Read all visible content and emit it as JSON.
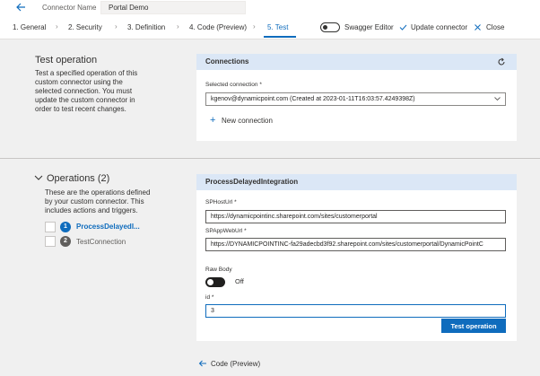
{
  "header": {
    "connector_label": "Connector Name",
    "connector_name": "Portal Demo"
  },
  "steps": [
    {
      "label": "1. General"
    },
    {
      "label": "2. Security"
    },
    {
      "label": "3. Definition"
    },
    {
      "label": "4. Code (Preview)"
    },
    {
      "label": "5. Test"
    }
  ],
  "toolbar": {
    "swagger_label": "Swagger Editor",
    "update_label": "Update connector",
    "close_label": "Close"
  },
  "test_operation": {
    "title": "Test operation",
    "description": [
      "Test a specified operation of this",
      "custom connector using the",
      "selected connection. You must",
      "update the custom connector in",
      "order to test recent changes."
    ]
  },
  "connections": {
    "header": "Connections",
    "selected_label": "Selected connection *",
    "selected_value": "kgenov@dynamicpoint.com (Created at 2023-01-11T16:03:57.4249398Z)",
    "new_connection": "New connection"
  },
  "operations": {
    "title": "Operations (2)",
    "description": [
      "These are the operations defined",
      "by your custom connector. This",
      "includes actions and triggers."
    ],
    "items": [
      {
        "number": "1",
        "label": "ProcessDelayedI...",
        "active": true
      },
      {
        "number": "2",
        "label": "TestConnection",
        "active": false
      }
    ]
  },
  "operation_form": {
    "header": "ProcessDelayedIntegration",
    "sphost_label": "SPHostUrl *",
    "sphost_value": "https://dynamicpointinc.sharepoint.com/sites/customerportal",
    "spapp_label": "SPAppWebUrl *",
    "spapp_value": "https://DYNAMICPOINTINC-fa29adecbd3f92.sharepoint.com/sites/customerportal/DynamicPointC",
    "raw_body_label": "Raw Body",
    "raw_body_state": "Off",
    "id_label": "id *",
    "id_value": "3",
    "test_button": "Test operation"
  },
  "footer": {
    "back_link": "Code (Preview)"
  },
  "colors": {
    "accent": "#0f6cbd",
    "card_header": "#dbe7f6",
    "background": "#f0f0f0"
  }
}
